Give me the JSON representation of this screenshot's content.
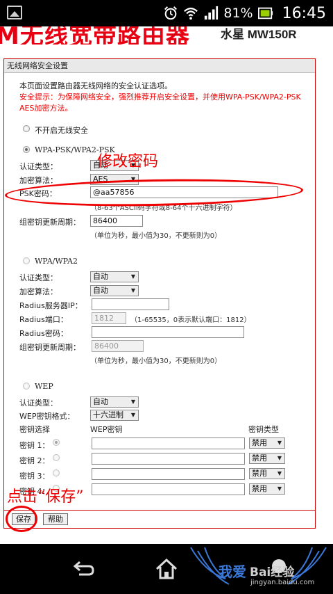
{
  "status_bar": {
    "battery_percent": "81%",
    "time": "16:45"
  },
  "banner": {
    "title": "M无线宽带路由器",
    "model": "水星 MW150R"
  },
  "panel": {
    "title": "无线网络安全设置",
    "description": "本页面设置路由器无线网络的安全认证选项。",
    "warning": "安全提示：为保障网络安全，强烈推荐开启安全设置，并使用WPA-PSK/WPA2-PSK AES加密方法。",
    "no_security_label": "不开启无线安全",
    "wpa_psk": {
      "label": "WPA-PSK/WPA2-PSK",
      "auth_type_label": "认证类型：",
      "auth_type_value": "自动",
      "encryption_label": "加密算法：",
      "encryption_value": "AES",
      "psk_label": "PSK密码：",
      "psk_value": "@aa57856",
      "psk_hint": "（8-63个ASCII码字符或8-64个十六进制字符）",
      "rekey_label": "组密钥更新周期：",
      "rekey_value": "86400",
      "rekey_hint": "（单位为秒，最小值为30，不更新则为0）"
    },
    "wpa": {
      "label": "WPA/WPA2",
      "auth_type_label": "认证类型：",
      "auth_type_value": "自动",
      "encryption_label": "加密算法：",
      "encryption_value": "自动",
      "radius_ip_label": "Radius服务器IP：",
      "radius_ip_value": "",
      "radius_port_label": "Radius端口：",
      "radius_port_value": "1812",
      "radius_port_hint": "（1-65535，0表示默认端口：1812）",
      "radius_pwd_label": "Radius密码：",
      "radius_pwd_value": "",
      "rekey_label": "组密钥更新周期：",
      "rekey_value": "86400",
      "rekey_hint": "（单位为秒，最小值为30，不更新则为0）"
    },
    "wep": {
      "label": "WEP",
      "auth_type_label": "认证类型：",
      "auth_type_value": "自动",
      "key_format_label": "WEP密钥格式：",
      "key_format_value": "十六进制",
      "col_key_select": "密钥选择",
      "col_wep_key": "WEP密钥",
      "col_key_type": "密钥类型",
      "keys": [
        {
          "label": "密钥 1：",
          "value": "",
          "type": "禁用"
        },
        {
          "label": "密钥 2：",
          "value": "",
          "type": "禁用"
        },
        {
          "label": "密钥 3：",
          "value": "",
          "type": "禁用"
        },
        {
          "label": "密钥 4：",
          "value": "",
          "type": "禁用"
        }
      ]
    },
    "save_button": "保存",
    "help_button": "帮助"
  },
  "annotations": {
    "change_password": "修改密码",
    "click_save": "点击“保存”"
  },
  "watermark": {
    "brand": "Bai经验",
    "url": "jingyan.baidu.com",
    "prefix": "我爱"
  },
  "colors": {
    "accent_red": "#e00000",
    "status_bar": "#000000",
    "watermark_blue": "#1e5fb5"
  }
}
